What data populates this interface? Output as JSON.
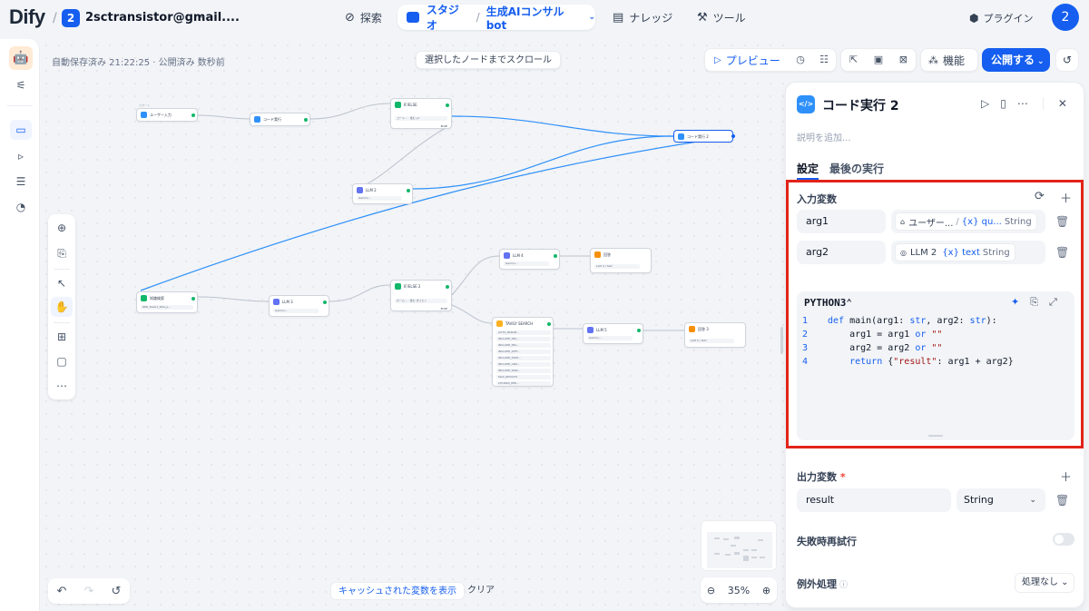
{
  "header": {
    "logo": "Dify",
    "workspace_badge": "2",
    "workspace_name": "2sctransistor@gmail....",
    "nav": {
      "explore": "探索",
      "studio": "スタジオ",
      "app_name": "生成AIコンサルbot",
      "knowledge": "ナレッジ",
      "tools": "ツール"
    },
    "plugins": "プラグイン",
    "avatar": "2"
  },
  "toolbar": {
    "autosave": "自動保存済み 21:22:25 · 公開済み 数秒前",
    "scroll_to_node": "選択したノードまでスクロール",
    "preview": "プレビュー",
    "features": "機能",
    "publish": "公開する"
  },
  "canvas_nodes": {
    "start_tag": "スタート",
    "user_input": "ユーザー入力",
    "code_exec": "コード実行",
    "if_else": "IF/ELSE",
    "if_row": "コード...",
    "if_cond": "含む yo",
    "else_label": "ELSE",
    "llm2": "LLM 2",
    "model": "Gemini...",
    "code_exec2": "コード実行 2",
    "knowledge": "知識検索",
    "knowledge_sub": "RRR_Desk1_RAG_p...",
    "llm3": "LLM 3",
    "if_else2": "IF/ELSE 2",
    "if2_row": "ホーム...",
    "if2_cond": "含む まったく",
    "llm4": "LLM 4",
    "answer": "回答",
    "answer_sub": "LLM 4 / text",
    "tavily": "TAVILY SEARCH",
    "tavily_params": [
      "AUTO_PARAM...",
      "INCLUDE_IMA...",
      "INCLUDE_IMA...",
      "INCLUDE_DIFF...",
      "INCLUDE_DOM...",
      "INCLUDE_ANS...",
      "INCLUDE_RAW...",
      "MAX_RESULTS",
      "CHUNKS_PER..."
    ],
    "llm5": "LLM 5",
    "answer3": "回答 3",
    "answer3_sub": "LLM 5 / text"
  },
  "bottom": {
    "show_cache": "キャッシュされた変数を表示",
    "clear": "クリア",
    "zoom": "35%"
  },
  "panel": {
    "title": "コード実行 2",
    "desc_placeholder": "説明を追加...",
    "tabs": [
      "設定",
      "最後の実行"
    ],
    "input_vars_title": "入力変数",
    "inputs": [
      {
        "name": "arg1",
        "node": "ユーザー...",
        "var": "qu...",
        "type": "String"
      },
      {
        "name": "arg2",
        "node": "LLM 2",
        "var": "text",
        "type": "String"
      }
    ],
    "language": "PYTHON3",
    "code_lines": [
      {
        "n": "1",
        "text": "def main(arg1: str, arg2: str):"
      },
      {
        "n": "2",
        "text": "    arg1 = arg1 or \"\""
      },
      {
        "n": "3",
        "text": "    arg2 = arg2 or \"\""
      },
      {
        "n": "4",
        "text": "    return {\"result\": arg1 + arg2}"
      }
    ],
    "output_vars_title": "出力変数",
    "output": {
      "name": "result",
      "type": "String"
    },
    "retry_title": "失敗時再試行",
    "exception_title": "例外処理",
    "exception_value": "処理なし"
  },
  "colors": {
    "accent": "#155eef",
    "highlight_box": "#e2231a",
    "port_green": "#12b76a"
  }
}
